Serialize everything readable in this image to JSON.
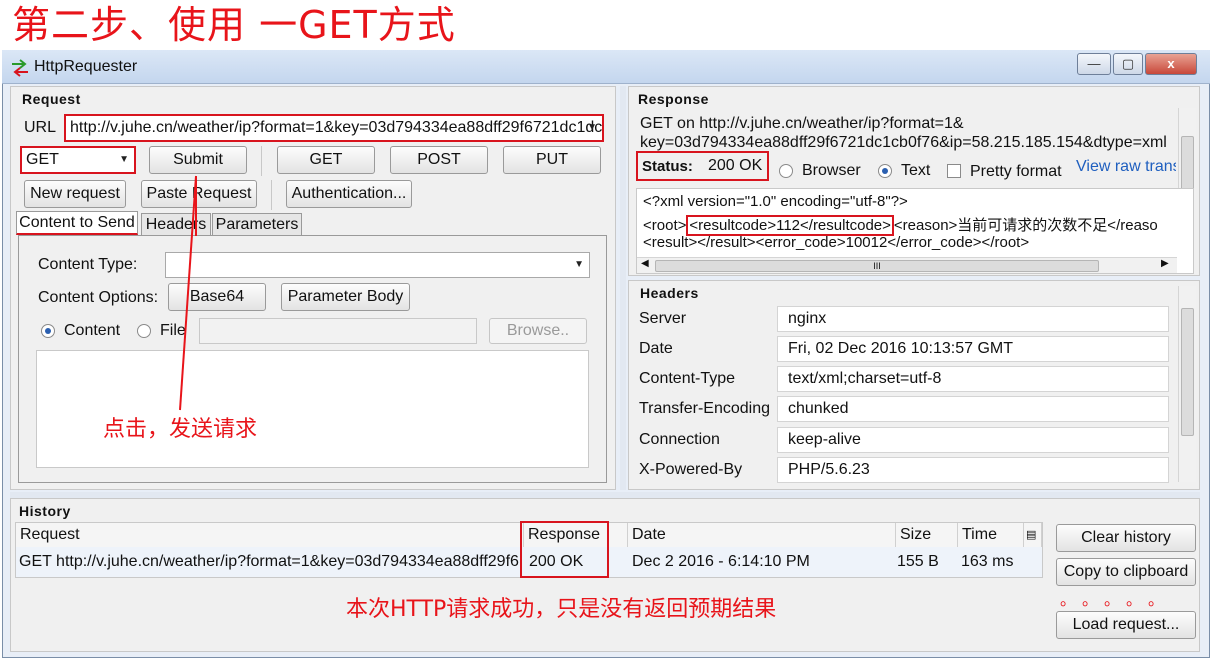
{
  "page_title": "第二步、使用 一GET方式",
  "window": {
    "title": "HttpRequester",
    "min_label": "—",
    "max_label": "▢",
    "close_label": "x"
  },
  "request": {
    "header": "Request",
    "url_label": "URL",
    "url_value": "http://v.juhe.cn/weather/ip?format=1&key=03d794334ea88dff29f6721dc1dc",
    "method_value": "GET",
    "submit_label": "Submit",
    "method_buttons": [
      "GET",
      "POST",
      "PUT"
    ],
    "new_request_label": "New request",
    "paste_request_label": "Paste Request",
    "authentication_label": "Authentication...",
    "tabs": [
      "Content to Send",
      "Headers",
      "Parameters"
    ],
    "content_type_label": "Content Type:",
    "content_options_label": "Content Options:",
    "base64_label": "Base64",
    "parameter_body_label": "Parameter Body",
    "content_radio_label": "Content",
    "file_radio_label": "File",
    "browse_label": "Browse..",
    "annotation": "点击，发送请求"
  },
  "response": {
    "header": "Response",
    "request_line1": "GET on http://v.juhe.cn/weather/ip?format=1&",
    "request_line2": "key=03d794334ea88dff29f6721dc1cb0f76&ip=58.215.185.154&dtype=xml",
    "status_label": "Status:",
    "status_value": "200 OK",
    "view_browser": "Browser",
    "view_text": "Text",
    "pretty_format": "Pretty format",
    "view_raw": "View raw trans",
    "body_line1": "<?xml version=\"1.0\" encoding=\"utf-8\"?>",
    "body_line2_a": "<root>",
    "body_line2_b": "<resultcode>112</resultcode>",
    "body_line2_c": "<reason>当前可请求的次数不足</reaso",
    "body_line3": "<result></result><error_code>10012</error_code></root>",
    "hscroll_grip": "III"
  },
  "headers": {
    "header": "Headers",
    "rows": [
      {
        "name": "Server",
        "value": "nginx"
      },
      {
        "name": "Date",
        "value": "Fri, 02 Dec 2016 10:13:57 GMT"
      },
      {
        "name": "Content-Type",
        "value": "text/xml;charset=utf-8"
      },
      {
        "name": "Transfer-Encoding",
        "value": "chunked"
      },
      {
        "name": "Connection",
        "value": "keep-alive"
      },
      {
        "name": "X-Powered-By",
        "value": "PHP/5.6.23"
      }
    ]
  },
  "history": {
    "header": "History",
    "columns": [
      "Request",
      "Response",
      "Date",
      "Size",
      "Time"
    ],
    "rows": [
      {
        "request": "GET http://v.juhe.cn/weather/ip?format=1&key=03d794334ea88dff29f6...",
        "response": "200 OK",
        "date": "Dec 2 2016 - 6:14:10 PM",
        "size": "155 B",
        "time": "163 ms"
      }
    ],
    "clear_history_label": "Clear history",
    "copy_clipboard_label": "Copy to clipboard",
    "load_request_label": "Load request...",
    "annotation": "本次HTTP请求成功，只是没有返回预期结果",
    "dots": "。。。。。"
  },
  "colors": {
    "annotation_red": "#e8141a",
    "link_blue": "#1f5fbf"
  }
}
